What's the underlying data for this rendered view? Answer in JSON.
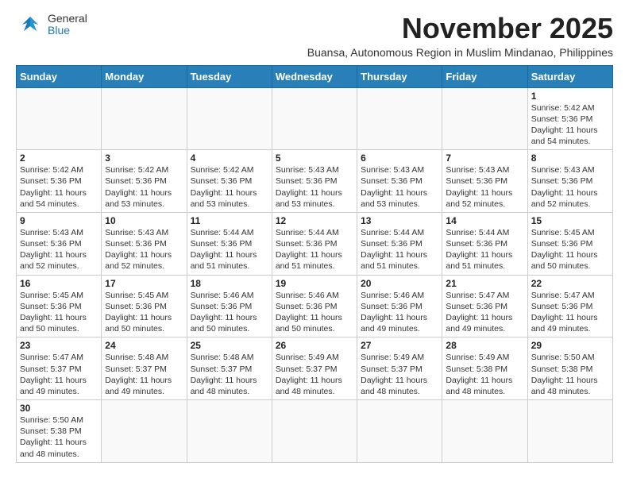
{
  "header": {
    "logo_general": "General",
    "logo_blue": "Blue",
    "month_title": "November 2025",
    "subtitle": "Buansa, Autonomous Region in Muslim Mindanao, Philippines"
  },
  "weekdays": [
    "Sunday",
    "Monday",
    "Tuesday",
    "Wednesday",
    "Thursday",
    "Friday",
    "Saturday"
  ],
  "weeks": [
    [
      {
        "day": "",
        "info": ""
      },
      {
        "day": "",
        "info": ""
      },
      {
        "day": "",
        "info": ""
      },
      {
        "day": "",
        "info": ""
      },
      {
        "day": "",
        "info": ""
      },
      {
        "day": "",
        "info": ""
      },
      {
        "day": "1",
        "info": "Sunrise: 5:42 AM\nSunset: 5:36 PM\nDaylight: 11 hours\nand 54 minutes."
      }
    ],
    [
      {
        "day": "2",
        "info": "Sunrise: 5:42 AM\nSunset: 5:36 PM\nDaylight: 11 hours\nand 54 minutes."
      },
      {
        "day": "3",
        "info": "Sunrise: 5:42 AM\nSunset: 5:36 PM\nDaylight: 11 hours\nand 53 minutes."
      },
      {
        "day": "4",
        "info": "Sunrise: 5:42 AM\nSunset: 5:36 PM\nDaylight: 11 hours\nand 53 minutes."
      },
      {
        "day": "5",
        "info": "Sunrise: 5:43 AM\nSunset: 5:36 PM\nDaylight: 11 hours\nand 53 minutes."
      },
      {
        "day": "6",
        "info": "Sunrise: 5:43 AM\nSunset: 5:36 PM\nDaylight: 11 hours\nand 53 minutes."
      },
      {
        "day": "7",
        "info": "Sunrise: 5:43 AM\nSunset: 5:36 PM\nDaylight: 11 hours\nand 52 minutes."
      },
      {
        "day": "8",
        "info": "Sunrise: 5:43 AM\nSunset: 5:36 PM\nDaylight: 11 hours\nand 52 minutes."
      }
    ],
    [
      {
        "day": "9",
        "info": "Sunrise: 5:43 AM\nSunset: 5:36 PM\nDaylight: 11 hours\nand 52 minutes."
      },
      {
        "day": "10",
        "info": "Sunrise: 5:43 AM\nSunset: 5:36 PM\nDaylight: 11 hours\nand 52 minutes."
      },
      {
        "day": "11",
        "info": "Sunrise: 5:44 AM\nSunset: 5:36 PM\nDaylight: 11 hours\nand 51 minutes."
      },
      {
        "day": "12",
        "info": "Sunrise: 5:44 AM\nSunset: 5:36 PM\nDaylight: 11 hours\nand 51 minutes."
      },
      {
        "day": "13",
        "info": "Sunrise: 5:44 AM\nSunset: 5:36 PM\nDaylight: 11 hours\nand 51 minutes."
      },
      {
        "day": "14",
        "info": "Sunrise: 5:44 AM\nSunset: 5:36 PM\nDaylight: 11 hours\nand 51 minutes."
      },
      {
        "day": "15",
        "info": "Sunrise: 5:45 AM\nSunset: 5:36 PM\nDaylight: 11 hours\nand 50 minutes."
      }
    ],
    [
      {
        "day": "16",
        "info": "Sunrise: 5:45 AM\nSunset: 5:36 PM\nDaylight: 11 hours\nand 50 minutes."
      },
      {
        "day": "17",
        "info": "Sunrise: 5:45 AM\nSunset: 5:36 PM\nDaylight: 11 hours\nand 50 minutes."
      },
      {
        "day": "18",
        "info": "Sunrise: 5:46 AM\nSunset: 5:36 PM\nDaylight: 11 hours\nand 50 minutes."
      },
      {
        "day": "19",
        "info": "Sunrise: 5:46 AM\nSunset: 5:36 PM\nDaylight: 11 hours\nand 50 minutes."
      },
      {
        "day": "20",
        "info": "Sunrise: 5:46 AM\nSunset: 5:36 PM\nDaylight: 11 hours\nand 49 minutes."
      },
      {
        "day": "21",
        "info": "Sunrise: 5:47 AM\nSunset: 5:36 PM\nDaylight: 11 hours\nand 49 minutes."
      },
      {
        "day": "22",
        "info": "Sunrise: 5:47 AM\nSunset: 5:36 PM\nDaylight: 11 hours\nand 49 minutes."
      }
    ],
    [
      {
        "day": "23",
        "info": "Sunrise: 5:47 AM\nSunset: 5:37 PM\nDaylight: 11 hours\nand 49 minutes."
      },
      {
        "day": "24",
        "info": "Sunrise: 5:48 AM\nSunset: 5:37 PM\nDaylight: 11 hours\nand 49 minutes."
      },
      {
        "day": "25",
        "info": "Sunrise: 5:48 AM\nSunset: 5:37 PM\nDaylight: 11 hours\nand 48 minutes."
      },
      {
        "day": "26",
        "info": "Sunrise: 5:49 AM\nSunset: 5:37 PM\nDaylight: 11 hours\nand 48 minutes."
      },
      {
        "day": "27",
        "info": "Sunrise: 5:49 AM\nSunset: 5:37 PM\nDaylight: 11 hours\nand 48 minutes."
      },
      {
        "day": "28",
        "info": "Sunrise: 5:49 AM\nSunset: 5:38 PM\nDaylight: 11 hours\nand 48 minutes."
      },
      {
        "day": "29",
        "info": "Sunrise: 5:50 AM\nSunset: 5:38 PM\nDaylight: 11 hours\nand 48 minutes."
      }
    ],
    [
      {
        "day": "30",
        "info": "Sunrise: 5:50 AM\nSunset: 5:38 PM\nDaylight: 11 hours\nand 48 minutes."
      },
      {
        "day": "",
        "info": ""
      },
      {
        "day": "",
        "info": ""
      },
      {
        "day": "",
        "info": ""
      },
      {
        "day": "",
        "info": ""
      },
      {
        "day": "",
        "info": ""
      },
      {
        "day": "",
        "info": ""
      }
    ]
  ]
}
